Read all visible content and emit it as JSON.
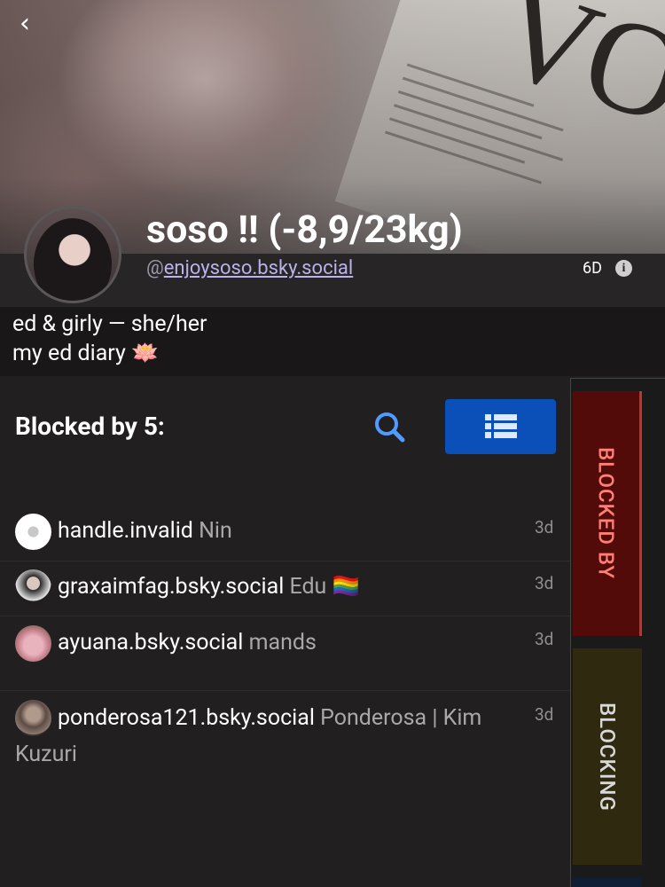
{
  "header": {
    "back_symbol": "‹",
    "display_name": "soso !! (-8,9/23kg)",
    "handle_prefix": "@",
    "handle": "enjoysoso.bsky.social",
    "age": "6D"
  },
  "bio": {
    "line1": "ed & girly — she/her",
    "line2": "my ed diary 🪷"
  },
  "list": {
    "title": "Blocked by 5:",
    "rows": [
      {
        "handle": "handle.invalid",
        "nick": "Nin",
        "time": "3d"
      },
      {
        "handle": "graxaimfag.bsky.social",
        "nick": "Edu 🏳️‍🌈",
        "time": "3d"
      },
      {
        "handle": "ayuana.bsky.social",
        "nick": "mands",
        "time": "3d"
      },
      {
        "handle": "ponderosa121.bsky.social",
        "nick": "Ponderosa | Kim",
        "nick_wrap": "Kuzuri",
        "time": "3d"
      }
    ]
  },
  "tabs": {
    "blocked_by": "BLOCKED BY",
    "blocking": "BLOCKING"
  },
  "colors": {
    "accent_blue": "#0b4fb8",
    "blocked_by_tab": "#520b08",
    "blocking_tab": "#2f2910"
  }
}
